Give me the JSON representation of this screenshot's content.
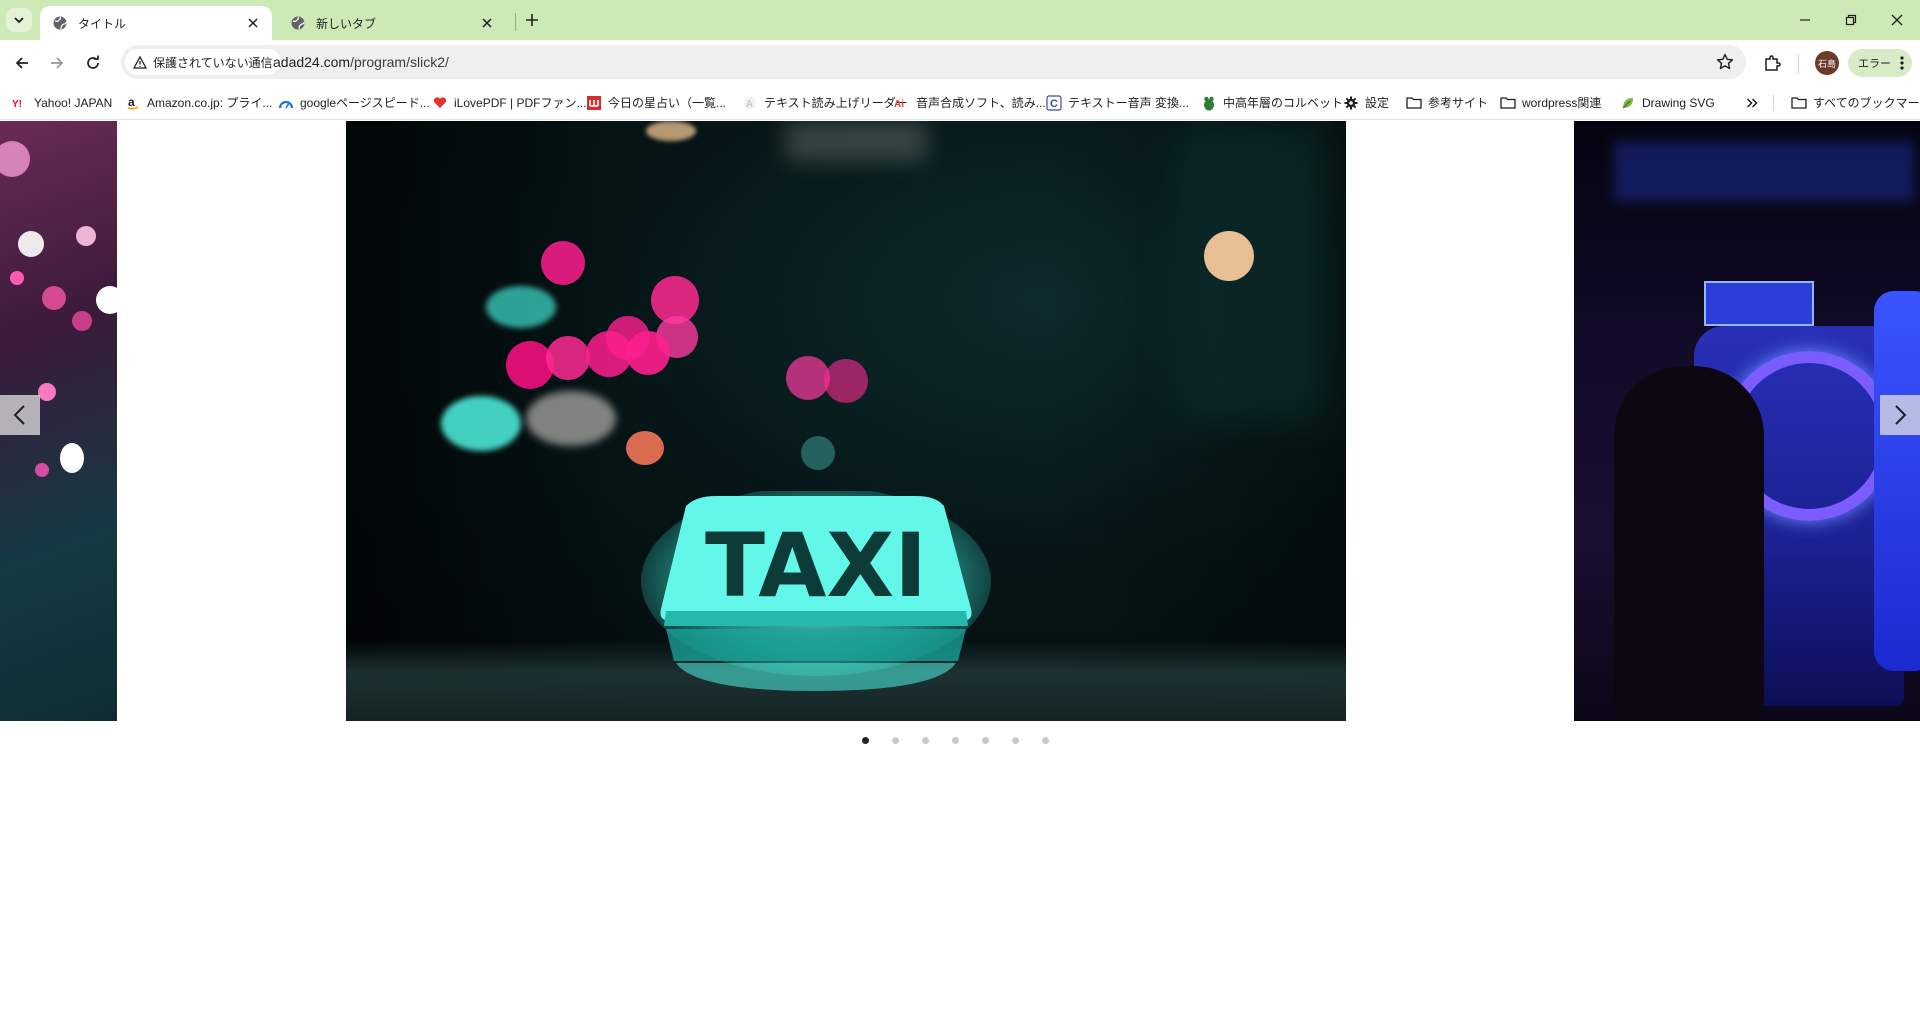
{
  "tabs": [
    {
      "title": "タイトル",
      "active": true
    },
    {
      "title": "新しいタブ",
      "active": false
    }
  ],
  "toolbar": {
    "security_label": "保護されていない通信",
    "url_host": "adad24.com",
    "url_path": "/program/slick2/",
    "avatar_text": "石島",
    "error_label": "エラー"
  },
  "bookmarks": [
    {
      "label": "Yahoo! JAPAN",
      "icon": "yahoo-icon"
    },
    {
      "label": "Amazon.co.jp: プライ...",
      "icon": "amazon-icon"
    },
    {
      "label": "googleページスピード...",
      "icon": "pagespeed-icon"
    },
    {
      "label": "iLovePDF | PDFファン...",
      "icon": "ilovepdf-icon"
    },
    {
      "label": "今日の星占い（一覧...",
      "icon": "horoscope-icon"
    },
    {
      "label": "テキスト読み上げリーダー",
      "icon": "tts-icon"
    },
    {
      "label": "音声合成ソフト、読み...",
      "icon": "ai-voice-icon"
    },
    {
      "label": "テキストー音声 変換...",
      "icon": "text-to-speech-icon"
    },
    {
      "label": "中高年層のコルベット",
      "icon": "frog-icon"
    },
    {
      "label": "設定",
      "icon": "gear-icon"
    },
    {
      "label": "参考サイト",
      "icon": "folder-icon"
    },
    {
      "label": "wordpress関連",
      "icon": "folder-icon"
    },
    {
      "label": "Drawing SVG",
      "icon": "leaf-icon"
    }
  ],
  "all_bookmarks_label": "すべてのブックマーク",
  "carousel": {
    "slide_count": 7,
    "active_index": 0,
    "taxi_sign_text": "TAXI"
  },
  "colors": {
    "tabstrip_bg": "#cde9b6",
    "taxi_cyan": "#3ff5e6",
    "bokeh_pink": "#ff1f8e"
  }
}
